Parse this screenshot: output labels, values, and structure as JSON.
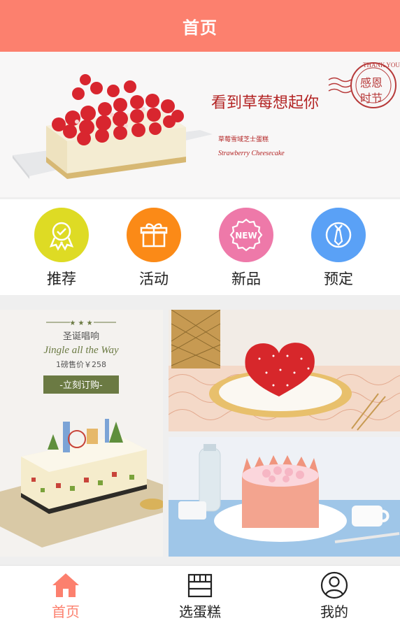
{
  "header": {
    "title": "首页"
  },
  "banner": {
    "headline": "看到草莓想起你",
    "product_name": "草莓雪域芝士蛋糕",
    "product_name_en": "Strawberry Cheesecake",
    "stamp_top": "THANK YOU",
    "stamp_main_line1": "感恩",
    "stamp_main_line2": "时节"
  },
  "categories": [
    {
      "label": "推荐",
      "icon": "medal-icon",
      "color": "#dedb24"
    },
    {
      "label": "活动",
      "icon": "gift-icon",
      "color": "#fb8a17"
    },
    {
      "label": "新品",
      "icon": "new-badge-icon",
      "color": "#ee79a9"
    },
    {
      "label": "预定",
      "icon": "tie-icon",
      "color": "#5aa1f6"
    }
  ],
  "promo_left": {
    "stars": "★ ★ ★",
    "title": "圣诞唱响",
    "script": "Jingle all the Way",
    "price": "1磅售价￥258",
    "cta": "-立刻订购-"
  },
  "tabs": [
    {
      "label": "首页",
      "icon": "home-icon",
      "active": true
    },
    {
      "label": "选蛋糕",
      "icon": "cake-shop-icon",
      "active": false
    },
    {
      "label": "我的",
      "icon": "user-icon",
      "active": false
    }
  ],
  "colors": {
    "accent": "#fc806e",
    "promo_cta_bg": "#6b7a43"
  }
}
